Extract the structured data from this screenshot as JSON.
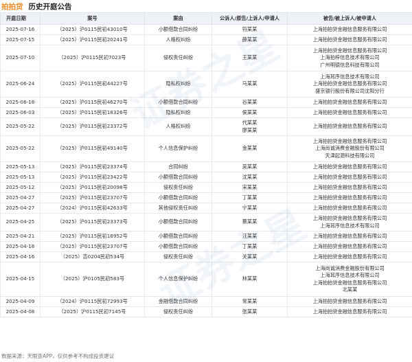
{
  "header": {
    "brand": "拍拍贷",
    "title": "历史开庭公告"
  },
  "table": {
    "columns": [
      "开庭日期",
      "案号",
      "案由",
      "公诉人/原告/上诉人/申请人",
      "被告/被上诉人/被申请人"
    ],
    "rows": [
      {
        "date": "2025-07-16",
        "case_no": "（2025）沪0115民初43010号",
        "cause": "小额借款合同纠纷",
        "plaintiff": [
          "符某某"
        ],
        "defendant": [
          "上海拍拍贷金融信息服务有限公司"
        ]
      },
      {
        "date": "2025-07-15",
        "case_no": "（2025）沪0115民初20241号",
        "cause": "人格权纠纷",
        "plaintiff": [
          "薛某某"
        ],
        "defendant": [
          "上海拍拍贷金融信息服务有限公司"
        ]
      },
      {
        "date": "2025-07-10",
        "case_no": "（2025）沪0115民初7023号",
        "cause": "侵权责任纠纷",
        "plaintiff": [
          "王某某"
        ],
        "defendant": [
          "上海拍拍贷金融信息服务有限公司",
          "上海拍梓信息技术有限公司",
          "广州明德信息科技有限公司"
        ]
      },
      {
        "date": "2025-06-24",
        "case_no": "（2025）沪0115民初44227号",
        "cause": "隐私权纠纷",
        "plaintiff": [
          "马某某"
        ],
        "defendant": [
          "上海耳序信息技术有限公司",
          "上海拍拍贷金融信息服务有限公司",
          "盛京银行股份有限公司沈阳分行"
        ]
      },
      {
        "date": "2025-06-18",
        "case_no": "（2025）沪0115民初46270号",
        "cause": "小额借款合同纠纷",
        "plaintiff": [
          "谷某某"
        ],
        "defendant": [
          "上海拍拍贷金融信息服务有限公司"
        ]
      },
      {
        "date": "2025-06-03",
        "case_no": "（2025）沪0115民初18326号",
        "cause": "隐私权纠纷",
        "plaintiff": [
          "侯某某"
        ],
        "defendant": [
          "上海拍拍贷金融信息服务有限公司"
        ]
      },
      {
        "date": "2025-05-22",
        "case_no": "（2025）沪0115民初23372号",
        "cause": "人格权纠纷",
        "plaintiff": [
          "代某某",
          "廖某某"
        ],
        "defendant": [
          "上海拍拍贷金融信息服务有限公司"
        ]
      },
      {
        "date": "2025-05-22",
        "case_no": "（2025）沪0115民初49140号",
        "cause": "个人信息保护纠纷",
        "plaintiff": [
          "金某某"
        ],
        "defendant": [
          "上海拍拍贷金融信息服务有限公司",
          "上海尚诚消费金融股份有限公司",
          "天津起源科技有限公司"
        ]
      },
      {
        "date": "2025-05-13",
        "case_no": "（2025）沪0115民初23374号",
        "cause": "合同纠纷",
        "plaintiff": [
          "吴某某"
        ],
        "defendant": [
          "上海拍拍贷金融信息服务有限公司"
        ]
      },
      {
        "date": "2025-05-13",
        "case_no": "（2025）沪0115民初23422号",
        "cause": "小额借款合同纠纷",
        "plaintiff": [
          "沈某某"
        ],
        "defendant": [
          "上海拍拍贷金融信息服务有限公司"
        ]
      },
      {
        "date": "2025-05-12",
        "case_no": "（2025）沪0115民初20098号",
        "cause": "侵权责任纠纷",
        "plaintiff": [
          "宋某某"
        ],
        "defendant": [
          "上海拍拍贷金融信息服务有限公司"
        ]
      },
      {
        "date": "2025-04-27",
        "case_no": "（2025）沪0115民初23707号",
        "cause": "小额借款合同纠纷",
        "plaintiff": [
          "丁某某"
        ],
        "defendant": [
          "上海拍拍贷金融信息服务有限公司"
        ]
      },
      {
        "date": "2025-04-27",
        "case_no": "（2024）沪0115民初42633号",
        "cause": "其他侵权责任纠纷",
        "plaintiff": [
          "宁某某"
        ],
        "defendant": [
          "上海拍拍贷金融信息服务有限公司"
        ]
      },
      {
        "date": "2025-04-25",
        "case_no": "（2025）沪0115民初23373号",
        "cause": "小额借款合同纠纷",
        "plaintiff": [
          "蔡某某"
        ],
        "defendant": [
          "上海拍拍贷金融信息服务有限公司",
          "上海耳序信息技术有限公司"
        ]
      },
      {
        "date": "2025-04-21",
        "case_no": "（2025）沪0115民初18952号",
        "cause": "小额借款合同纠纷",
        "plaintiff": [
          "汪某某"
        ],
        "defendant": [
          "上海拍拍贷金融信息服务有限公司"
        ]
      },
      {
        "date": "2025-04-18",
        "case_no": "（2025）沪0115民初23707号",
        "cause": "小额借款合同纠纷",
        "plaintiff": [
          "丁某某"
        ],
        "defendant": [
          "上海拍拍贷金融信息服务有限公司"
        ]
      },
      {
        "date": "2025-04-16",
        "case_no": "（2025）吉0204民初534号",
        "cause": "侵权责任纠纷",
        "plaintiff": [
          "关某某"
        ],
        "defendant": [
          "上海拍拍贷金融信息服务有限公司"
        ]
      },
      {
        "date": "2025-04-15",
        "case_no": "（2025）沪0105民初583号",
        "cause": "个人信息保护纠纷",
        "plaintiff": [
          "林某某"
        ],
        "defendant": [
          "上海尚诚消费金融股份有限公司",
          "上海耳序信息技术有限公司",
          "上海拍拍贷金融信息服务有限公司",
          "北某某"
        ]
      },
      {
        "date": "2025-04-09",
        "case_no": "（2024）沪0115民初72993号",
        "cause": "金融借款合同纠纷",
        "plaintiff": [
          "常某某"
        ],
        "defendant": [
          "上海拍拍贷金融信息服务有限公司"
        ]
      },
      {
        "date": "2025-04-08",
        "case_no": "（2025）沪0115民初7145号",
        "cause": "侵权责任纠纷",
        "plaintiff": [
          "张某某"
        ],
        "defendant": [
          "上海拍拍贷金融信息服务有限公司"
        ]
      }
    ]
  },
  "footer": {
    "source": "数据来源：天眼查APP，仅供参考不构成投资建议"
  },
  "watermark": {
    "text": "证券之星"
  }
}
